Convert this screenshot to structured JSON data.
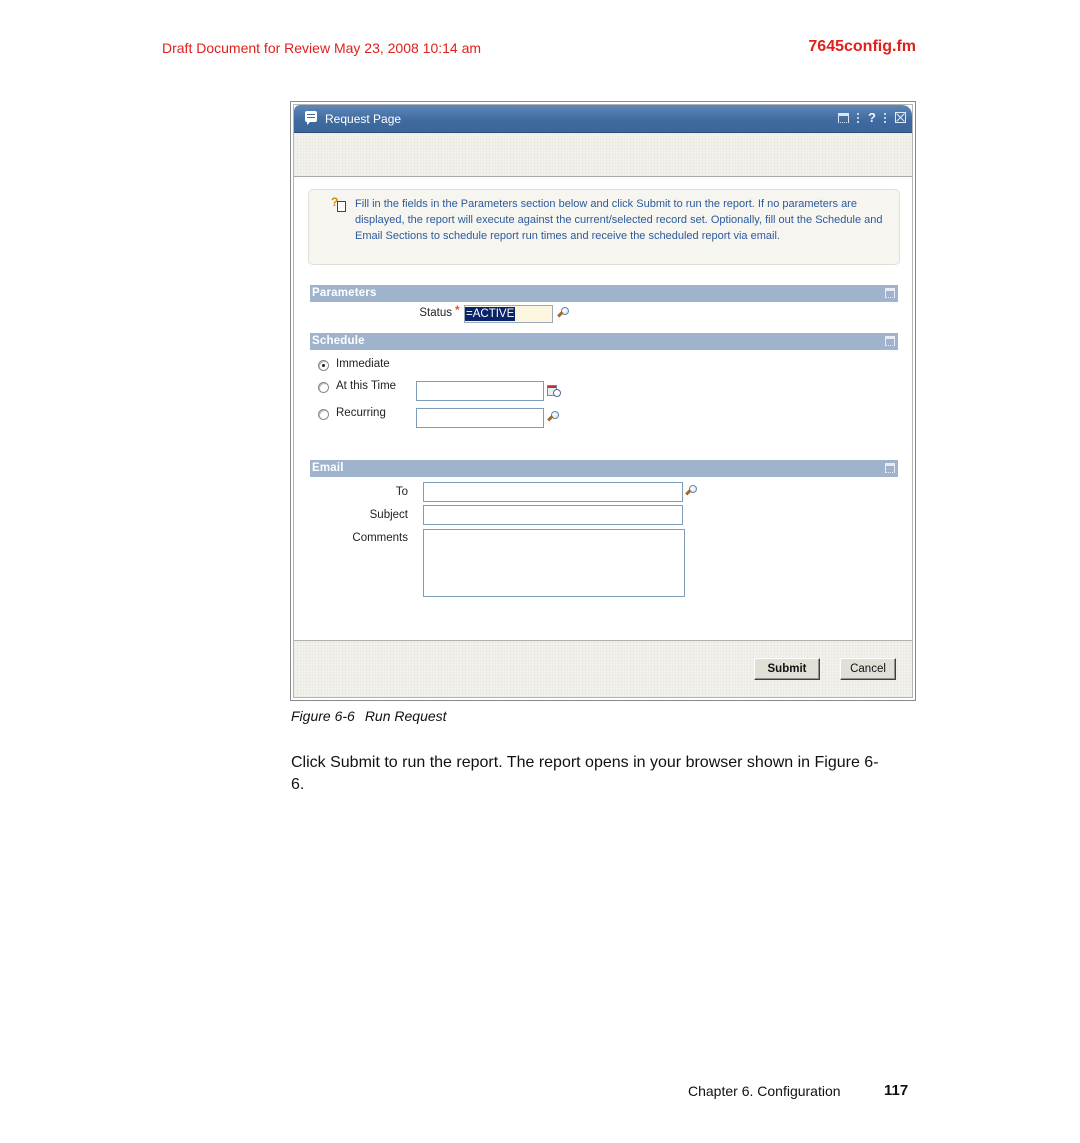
{
  "page_header": {
    "draft_notice": "Draft Document for Review May 23, 2008 10:14 am",
    "file_name": "7645config.fm"
  },
  "window": {
    "title": "Request Page",
    "title_icon": "comment-icon",
    "controls": [
      {
        "name": "minimize-icon"
      },
      {
        "name": "help-icon",
        "glyph": "?"
      },
      {
        "name": "close-icon"
      }
    ]
  },
  "info": {
    "icon": "help-document-icon",
    "text": "Fill in the fields in the Parameters section below and click Submit to run the report. If no parameters are displayed, the report will execute against the current/selected record set. Optionally, fill out the Schedule and Email Sections to schedule report run times and receive the scheduled report via email."
  },
  "parameters": {
    "section_label": "Parameters",
    "status_label": "Status",
    "required_marker": "*",
    "status_value": "=ACTIVE"
  },
  "schedule": {
    "section_label": "Schedule",
    "options": [
      {
        "label": "Immediate",
        "selected": true
      },
      {
        "label": "At this Time",
        "selected": false,
        "value": ""
      },
      {
        "label": "Recurring",
        "selected": false,
        "value": ""
      }
    ]
  },
  "email": {
    "section_label": "Email",
    "to_label": "To",
    "to_value": "",
    "subject_label": "Subject",
    "subject_value": "",
    "comments_label": "Comments",
    "comments_value": ""
  },
  "buttons": {
    "submit": "Submit",
    "cancel": "Cancel"
  },
  "caption": {
    "figure_number": "Figure 6-6",
    "figure_title": "Run Request"
  },
  "body_text": "Click Submit to run the report. The report opens in your browser shown in Figure 6-6.",
  "page_footer": {
    "chapter": "Chapter 6. Configuration",
    "page_number": "117"
  },
  "colors": {
    "header_red": "#e0201c",
    "titlebar_blue": "#3f6aa0",
    "section_bar": "#9fb4cc",
    "info_text_blue": "#2c5a9e",
    "selection_navy": "#0a246a"
  }
}
